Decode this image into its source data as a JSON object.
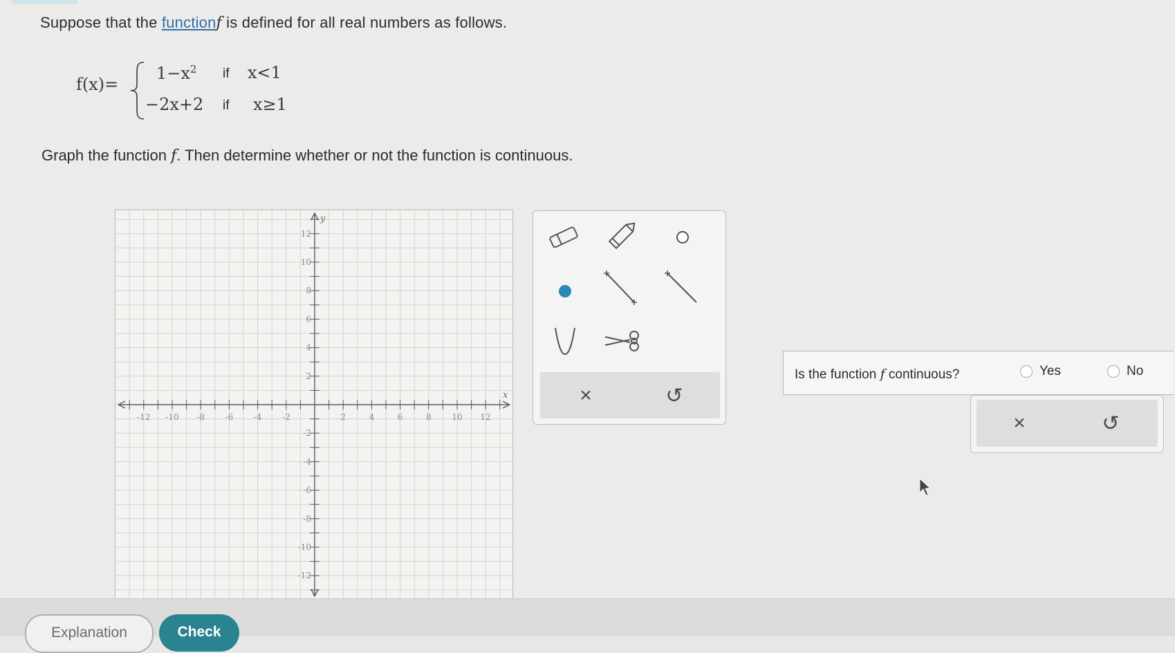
{
  "problem": {
    "prompt_before": "Suppose that the ",
    "prompt_link": "function",
    "prompt_var": "f",
    "prompt_after": " is defined for all real numbers as follows.",
    "fx_label": "f(x)=",
    "piece1_expr": "1−x",
    "piece1_exp": "2",
    "piece1_if": "if",
    "piece1_cond": "x<1",
    "piece2_expr": "−2x+2",
    "piece2_if": "if",
    "piece2_cond": "x≥1",
    "instruction_before": "Graph the function ",
    "instruction_var": "f",
    "instruction_after": ". Then determine whether or not the function is continuous."
  },
  "graph": {
    "x_axis_label": "x",
    "y_axis_label": "y",
    "x_range": [
      -13,
      13
    ],
    "y_range": [
      -14,
      13
    ],
    "tick_step": 1,
    "x_tick_labels": [
      "-12",
      "-10",
      "-8",
      "-6",
      "-4",
      "-2",
      "2",
      "4",
      "6",
      "8",
      "10",
      "12"
    ],
    "y_tick_labels": [
      "12",
      "10",
      "8",
      "6",
      "4",
      "2",
      "-2",
      "-4",
      "-6",
      "-8",
      "-10",
      "-12"
    ]
  },
  "tools": {
    "items": [
      "eraser-icon",
      "pencil-icon",
      "open-circle-icon",
      "closed-point-icon",
      "segment-icon",
      "ray-icon",
      "parabola-icon",
      "scissors-icon"
    ],
    "clear_symbol": "×",
    "undo_symbol": "↺",
    "accent_color": "#2a86b4"
  },
  "question": {
    "text_before": "Is the function ",
    "text_var": "f",
    "text_after": " continuous?",
    "option_yes": "Yes",
    "option_no": "No",
    "clear_symbol": "×",
    "undo_symbol": "↺"
  },
  "footer": {
    "explanation_label": "Explanation",
    "check_label": "Check",
    "check_color": "#2a8390"
  }
}
